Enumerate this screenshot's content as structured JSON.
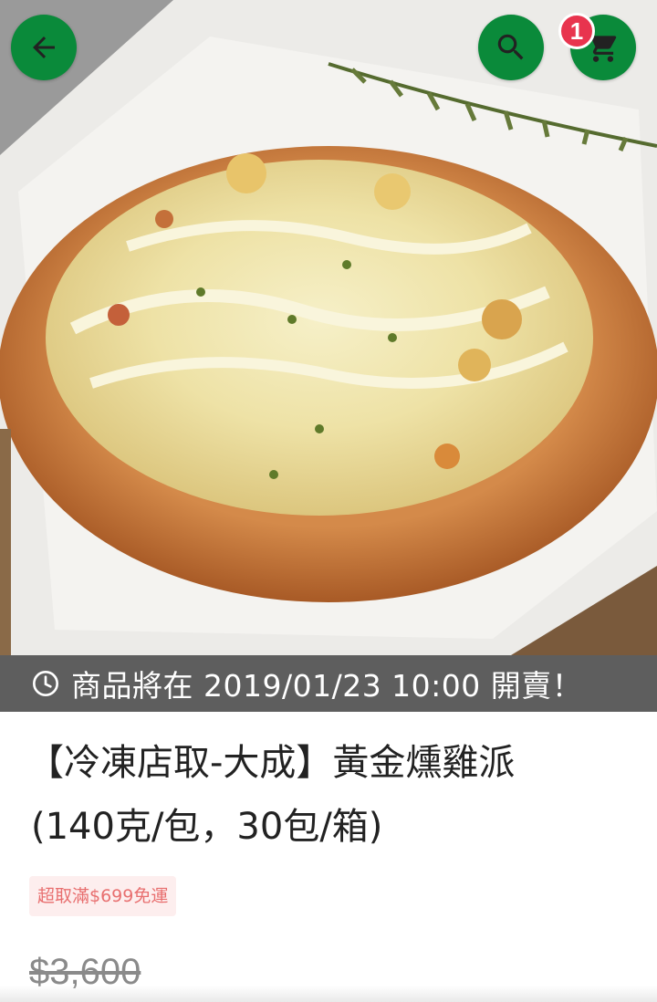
{
  "header": {
    "back_icon": "arrow-left-icon",
    "search_icon": "search-icon",
    "cart_icon": "cart-icon",
    "cart_badge_count": "1"
  },
  "product_image": {
    "icon": "pizza-photo"
  },
  "sale_banner": {
    "icon": "clock-icon",
    "text": "商品將在 2019/01/23 10:00 開賣！"
  },
  "product": {
    "title_line1": "【冷凍店取-大成】黃金燻雞派",
    "title_line2": "(140克/包，30包/箱)",
    "shipping_tag": "超取滿$699免運",
    "original_price": "$3,600"
  },
  "colors": {
    "accent_green": "#0a8a3a",
    "badge_red": "#e8344e",
    "banner_bg": "#484848",
    "tag_text": "#e86f6f"
  }
}
